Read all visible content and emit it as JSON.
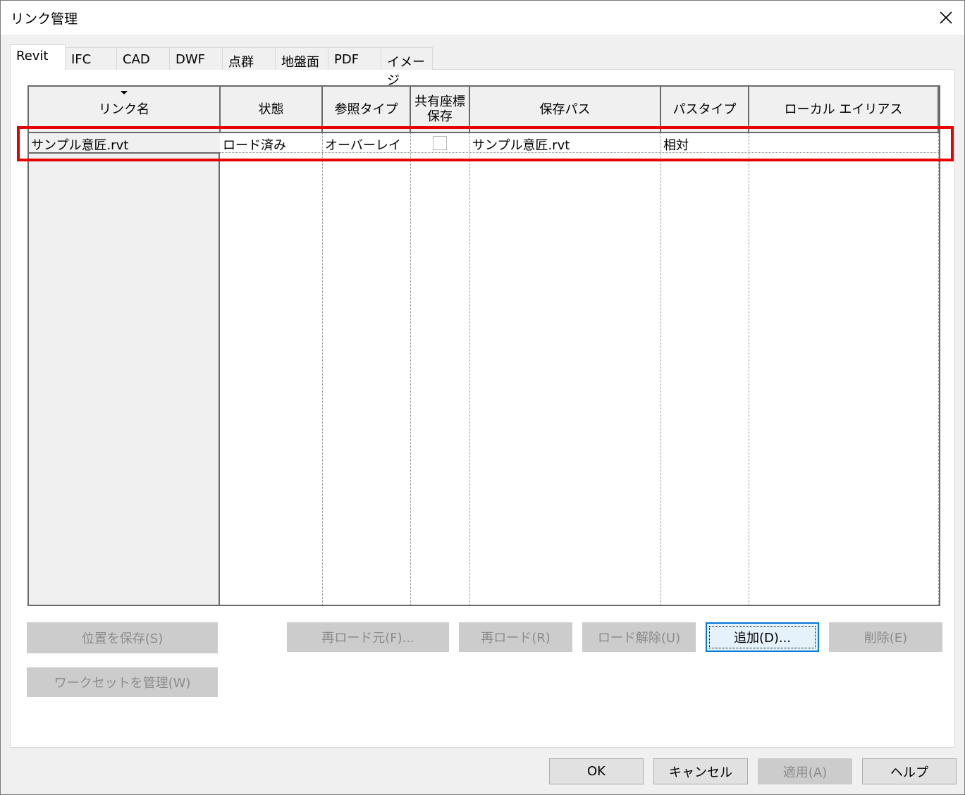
{
  "window": {
    "title": "リンク管理"
  },
  "tabs": [
    {
      "label": "Revit",
      "active": true
    },
    {
      "label": "IFC"
    },
    {
      "label": "CAD"
    },
    {
      "label": "DWF"
    },
    {
      "label": "点群"
    },
    {
      "label": "地盤面"
    },
    {
      "label": "PDF"
    },
    {
      "label": "イメージ"
    }
  ],
  "table": {
    "columns": [
      "リンク名",
      "状態",
      "参照タイプ",
      "共有座標\n保存",
      "保存パス",
      "パスタイプ",
      "ローカル エイリアス"
    ],
    "sorted_column": "リンク名",
    "rows": [
      {
        "link_name": "サンプル意匠.rvt",
        "status": "ロード済み",
        "reference_type": "オーバーレイ",
        "save_shared_coords": false,
        "saved_path": "サンプル意匠.rvt",
        "path_type": "相対",
        "local_alias": ""
      }
    ]
  },
  "buttons": {
    "save_positions": "位置を保存(S)",
    "manage_worksets": "ワークセットを管理(W)",
    "reload_from": "再ロード元(F)...",
    "reload": "再ロード(R)",
    "unload": "ロード解除(U)",
    "add": "追加(D)...",
    "remove": "削除(E)",
    "ok": "OK",
    "cancel": "キャンセル",
    "apply": "適用(A)",
    "help": "ヘルプ"
  },
  "colors": {
    "highlight": "#e60000",
    "focus": "#0078d7"
  }
}
